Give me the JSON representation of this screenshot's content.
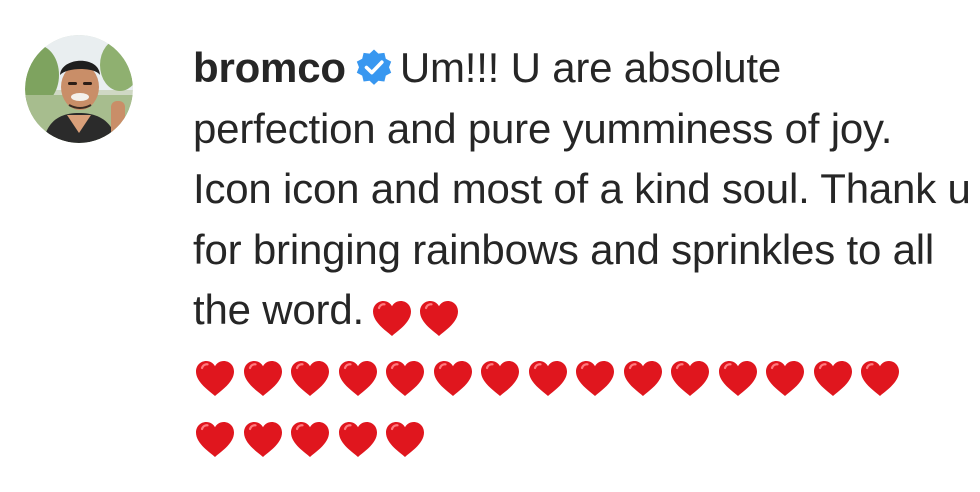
{
  "comment": {
    "username": "bromco",
    "verified": true,
    "text": "Um!!! U are absolute perfection and pure yumminess of joy. Icon icon and most of a kind soul. Thank u for bringing rainbows and sprinkles to all the word.",
    "emoji": "red-heart",
    "heart_rows": [
      2,
      15,
      5
    ]
  },
  "colors": {
    "text": "#262626",
    "verified_badge": "#3897f0",
    "heart": "#e0161e"
  },
  "icons": {
    "avatar": "profile-photo",
    "verified": "verified-badge-icon",
    "heart": "red-heart-emoji"
  }
}
